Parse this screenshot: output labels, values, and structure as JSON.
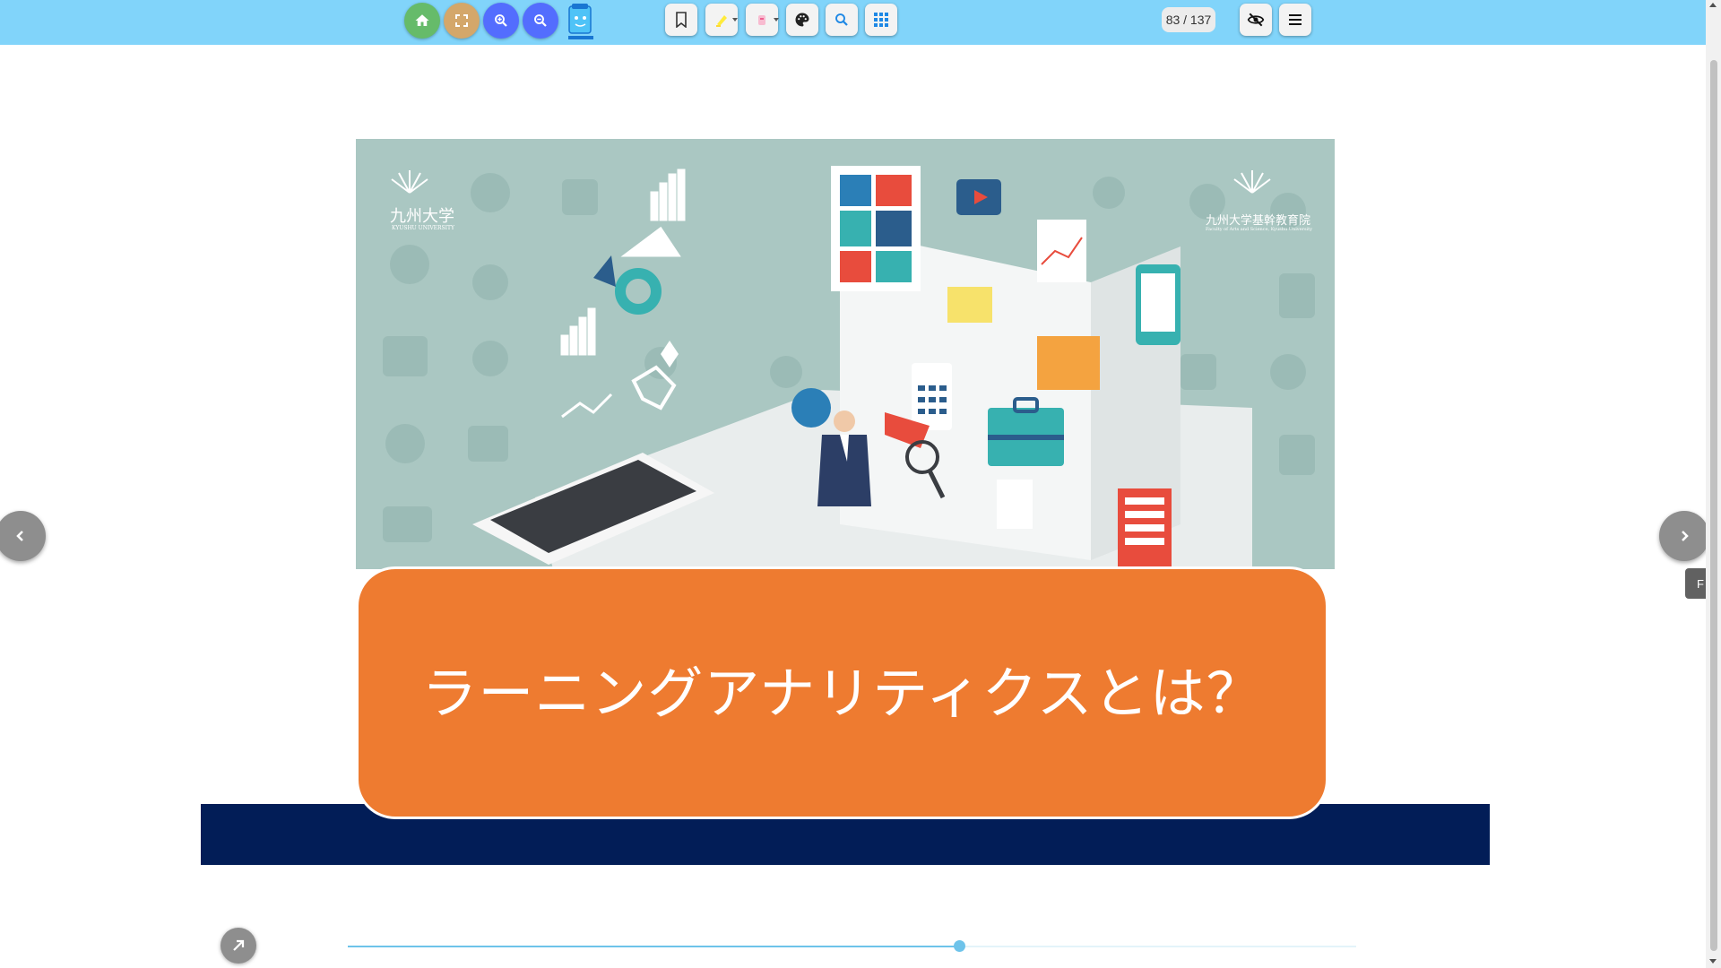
{
  "toolbar": {
    "page_counter": "83 / 137",
    "colors": {
      "bar": "#81d4fa",
      "home": "#66bb6a",
      "fullscreen": "#d4a76a",
      "zoom": "#536dfe"
    },
    "icons": [
      "home-icon",
      "fullscreen-icon",
      "zoom-in-icon",
      "zoom-out-icon",
      "app-logo-icon",
      "bookmark-icon",
      "highlighter-icon",
      "marker-icon",
      "palette-icon",
      "search-icon",
      "grid-icon",
      "hide-icon",
      "menu-icon"
    ]
  },
  "slide": {
    "title": "ラーニングアナリティクスとは？",
    "logo_left": "九州大学",
    "logo_left_sub": "KYUSHU UNIVERSITY",
    "logo_right": "九州大学基幹教育院",
    "logo_right_sub": "Faculty of Arts and Science, Kyushu University",
    "colors": {
      "title_box": "#ee7b30",
      "band": "#021d57",
      "background": "#aac7c2"
    }
  },
  "navigation": {
    "prev_icon": "chevron-left-icon",
    "next_icon": "chevron-right-icon",
    "side_tab_label": "F",
    "corner_icon": "arrow-up-right-icon"
  },
  "progress": {
    "current_page": 83,
    "total_pages": 137,
    "fraction": 0.6058
  }
}
